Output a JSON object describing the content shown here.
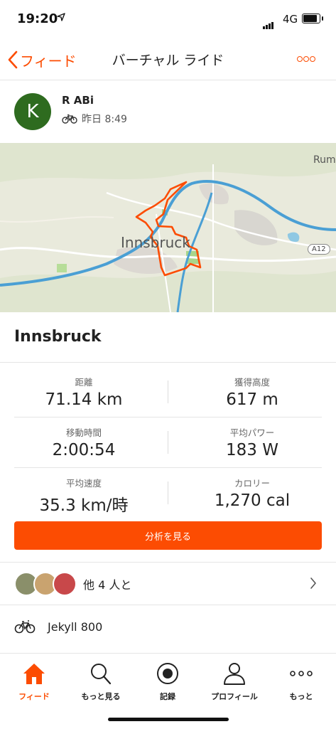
{
  "status_bar": {
    "time": "19:20",
    "network": "4G"
  },
  "nav": {
    "back_label": "フィード",
    "title": "バーチャル ライド"
  },
  "athlete": {
    "initial": "K",
    "name": "R ABi",
    "timestamp": "昨日 8:49"
  },
  "map": {
    "city_label": "Innsbruck",
    "edge_label": "Rum",
    "road_label": "A12",
    "route_color": "#fc4c02",
    "river_color": "#4a9fd4"
  },
  "activity": {
    "title": "Innsbruck"
  },
  "stats": [
    {
      "label": "距離",
      "value": "71.14 km"
    },
    {
      "label": "獲得高度",
      "value": "617 m"
    },
    {
      "label": "移動時間",
      "value": "2:00:54"
    },
    {
      "label": "平均パワー",
      "value": "183 W"
    },
    {
      "label": "平均速度",
      "value": "35.3 km/時"
    },
    {
      "label": "カロリー",
      "value": "1,270 cal"
    }
  ],
  "analysis_button": "分析を見る",
  "group": {
    "text": "他 4 人と"
  },
  "gear": {
    "name": "Jekyll 800"
  },
  "tabs": [
    {
      "label": "フィード",
      "icon": "home-icon",
      "active": true
    },
    {
      "label": "もっと見る",
      "icon": "search-icon",
      "active": false
    },
    {
      "label": "記録",
      "icon": "record-icon",
      "active": false
    },
    {
      "label": "プロフィール",
      "icon": "profile-icon",
      "active": false
    },
    {
      "label": "もっと",
      "icon": "more-dots-icon",
      "active": false
    }
  ],
  "colors": {
    "accent": "#fc4c02",
    "avatar_bg": "#2e6b1f"
  }
}
